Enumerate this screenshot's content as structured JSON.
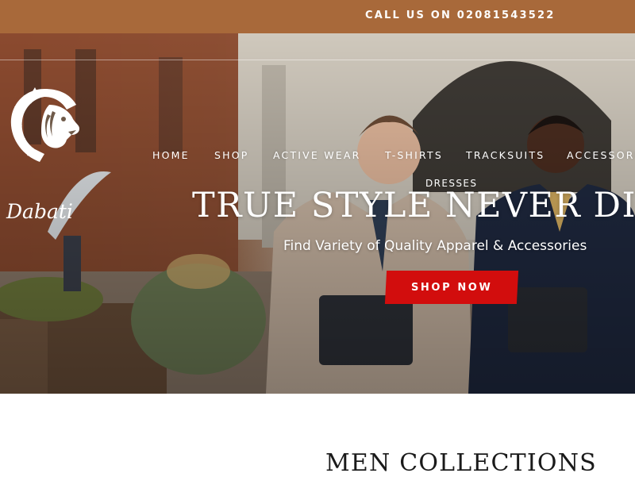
{
  "topbar": {
    "phone_text": "CALL US ON 02081543522"
  },
  "brand": {
    "name": "Dabati",
    "logo_icon": "lion-head-icon"
  },
  "nav": {
    "items": [
      "HOME",
      "SHOP",
      "ACTIVE WEAR",
      "T-SHIRTS",
      "TRACKSUITS",
      "ACCESSORIES"
    ],
    "second_row": "DRESSES"
  },
  "hero": {
    "headline": "TRUE STYLE NEVER DIES",
    "subheadline": "Find Variety of Quality Apparel & Accessories",
    "cta_label": "SHOP NOW"
  },
  "section": {
    "title": "MEN COLLECTIONS"
  },
  "colors": {
    "topbar": "#a8693a",
    "cta": "#d20d0d",
    "text_dark": "#1a1a1a"
  }
}
